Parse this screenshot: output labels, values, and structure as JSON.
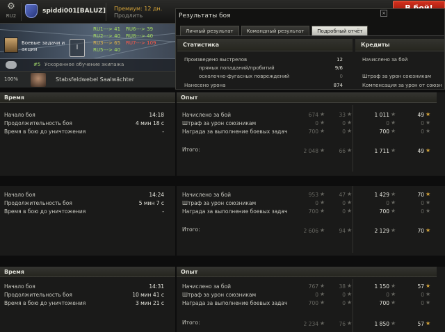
{
  "topbar": {
    "region": "RU2",
    "player_name": "spiddi001[BALUZ]",
    "premium_label": "Премиум: 12 дн.",
    "extend_label": "Продлить",
    "battle_button": "В бой!"
  },
  "hangar": {
    "quests_label": "Боевые задачи и акции",
    "tank_icon": "Ⅰ",
    "routes": [
      {
        "text": "RU1---> 41",
        "color": "green"
      },
      {
        "text": "RU2---> 40",
        "color": "green"
      },
      {
        "text": "RU3---> 65",
        "color": "gold"
      },
      {
        "text": "RU5---> 40",
        "color": "green"
      },
      {
        "text": "RU6---> 39",
        "color": "green"
      },
      {
        "text": "RU8---> 40",
        "color": "green"
      },
      {
        "text": "RU7---> 109",
        "color": "red"
      }
    ],
    "crew_pct": "#5",
    "crew_text": "Ускоренное обучение экипажа",
    "sgt_pct": "100%",
    "sgt_name": "Stabsfeldwebel Saalwächter"
  },
  "dialog": {
    "title": "Результаты боя",
    "tabs": [
      "Личный результат",
      "Командный результат",
      "Подробный отчёт"
    ],
    "active_tab": 2,
    "stats_header": "Статистика",
    "credits_header": "Кредиты",
    "stats": [
      {
        "label": "Произведено выстрелов",
        "value": "12"
      },
      {
        "label": "прямых попаданий/пробитий",
        "value": "9/6"
      },
      {
        "label": "осколочно-фугасных повреждений",
        "value": "0"
      },
      {
        "label": "Нанесено урона",
        "value": "874"
      }
    ],
    "credits": [
      {
        "label": "Начислено за бой"
      },
      {
        "label": "Штраф за урон союзникам"
      },
      {
        "label": "Компенсация за урон от союзн"
      }
    ]
  },
  "panels": [
    {
      "time_header": "Время",
      "exp_header": "Опыт",
      "start_label": "Начало боя",
      "start_value": "14:18",
      "duration_label": "Продолжительность боя",
      "duration_value": "4 мин 18 с",
      "alive_label": "Время в бою до уничтожения",
      "alive_value": "-",
      "rows": [
        {
          "label": "Начислено за бой",
          "v1": "674",
          "v2": "33",
          "v3": "1 011",
          "v4": "49"
        },
        {
          "label": "Штраф за урон союзникам",
          "v1": "0",
          "v2": "0",
          "v3": "0",
          "v4": "0"
        },
        {
          "label": "Награда за выполнение боевых задач",
          "v1": "700",
          "v2": "0",
          "v3": "700",
          "v4": "0"
        }
      ],
      "total_label": "Итого:",
      "total": {
        "v1": "2 048",
        "v2": "66",
        "v3": "1 711",
        "v4": "49"
      }
    },
    {
      "time_header": "",
      "exp_header": "",
      "start_label": "Начало боя",
      "start_value": "14:24",
      "duration_label": "Продолжительность боя",
      "duration_value": "5 мин 7 с",
      "alive_label": "Время в бою до уничтожения",
      "alive_value": "-",
      "rows": [
        {
          "label": "Начислено за бой",
          "v1": "953",
          "v2": "47",
          "v3": "1 429",
          "v4": "70"
        },
        {
          "label": "Штраф за урон союзникам",
          "v1": "0",
          "v2": "0",
          "v3": "0",
          "v4": "0"
        },
        {
          "label": "Награда за выполнение боевых задач",
          "v1": "700",
          "v2": "0",
          "v3": "700",
          "v4": "0"
        }
      ],
      "total_label": "Итого:",
      "total": {
        "v1": "2 606",
        "v2": "94",
        "v3": "2 129",
        "v4": "70"
      }
    },
    {
      "time_header": "Время",
      "exp_header": "Опыт",
      "start_label": "Начало боя",
      "start_value": "14:31",
      "duration_label": "Продолжительность боя",
      "duration_value": "10 мин 41 с",
      "alive_label": "Время в бою до уничтожения",
      "alive_value": "3 мин 21 с",
      "rows": [
        {
          "label": "Начислено за бой",
          "v1": "767",
          "v2": "38",
          "v3": "1 150",
          "v4": "57"
        },
        {
          "label": "Штраф за урон союзникам",
          "v1": "0",
          "v2": "0",
          "v3": "0",
          "v4": "0"
        },
        {
          "label": "Награда за выполнение боевых задач",
          "v1": "700",
          "v2": "0",
          "v3": "700",
          "v4": "0"
        }
      ],
      "total_label": "Итого:",
      "total": {
        "v1": "2 234",
        "v2": "76",
        "v3": "1 850",
        "v4": "57"
      }
    }
  ],
  "icons": {
    "gear": "gear-icon",
    "star": "star-icon",
    "close": "close-icon",
    "chevron": "chevron-down-icon"
  },
  "colors": {
    "accent_gold": "#d6a53a",
    "battle_red": "#c42a18",
    "route_green": "#a8e060",
    "route_red": "#ff5a4a"
  }
}
